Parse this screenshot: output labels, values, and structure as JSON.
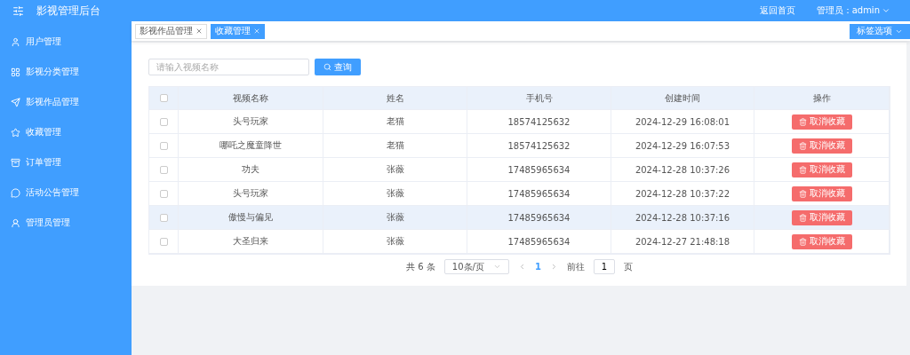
{
  "header": {
    "title": "影视管理后台",
    "home_link": "返回首页",
    "user_label": "管理员：admin"
  },
  "sidebar": {
    "items": [
      {
        "label": "用户管理",
        "selected": false
      },
      {
        "label": "影视分类管理",
        "selected": false
      },
      {
        "label": "影视作品管理",
        "selected": false
      },
      {
        "label": "收藏管理",
        "selected": false
      },
      {
        "label": "订单管理",
        "selected": false
      },
      {
        "label": "活动公告管理",
        "selected": false
      },
      {
        "label": "管理员管理",
        "selected": false
      }
    ]
  },
  "tabs": [
    {
      "label": "影视作品管理",
      "selected": false
    },
    {
      "label": "收藏管理",
      "selected": true
    }
  ],
  "tab_options": "标签选项",
  "search": {
    "placeholder": "请输入视频名称",
    "button": "查询"
  },
  "table": {
    "all_checked": false,
    "columns": [
      "视频名称",
      "姓名",
      "手机号",
      "创建时间",
      "操作"
    ],
    "rows": [
      {
        "checked": false,
        "hovered": false,
        "cells": [
          "头号玩家",
          "老猫",
          "18574125632",
          "2024-12-29 16:08:01"
        ],
        "action": "取消收藏"
      },
      {
        "checked": false,
        "hovered": false,
        "cells": [
          "哪吒之魔童降世",
          "老猫",
          "18574125632",
          "2024-12-29 16:07:53"
        ],
        "action": "取消收藏"
      },
      {
        "checked": false,
        "hovered": false,
        "cells": [
          "功夫",
          "张薇",
          "17485965634",
          "2024-12-28 10:37:26"
        ],
        "action": "取消收藏"
      },
      {
        "checked": false,
        "hovered": false,
        "cells": [
          "头号玩家",
          "张薇",
          "17485965634",
          "2024-12-28 10:37:22"
        ],
        "action": "取消收藏"
      },
      {
        "checked": false,
        "hovered": true,
        "cells": [
          "傲慢与偏见",
          "张薇",
          "17485965634",
          "2024-12-28 10:37:16"
        ],
        "action": "取消收藏"
      },
      {
        "checked": false,
        "hovered": false,
        "cells": [
          "大圣归来",
          "张薇",
          "17485965634",
          "2024-12-27 21:48:18"
        ],
        "action": "取消收藏"
      }
    ]
  },
  "pagination": {
    "total": "共 6 条",
    "page_size": "10条/页",
    "pages": [
      {
        "label": "1",
        "selected": true
      }
    ],
    "goto_label": "前往",
    "goto_value": "1",
    "goto_suffix": "页"
  }
}
